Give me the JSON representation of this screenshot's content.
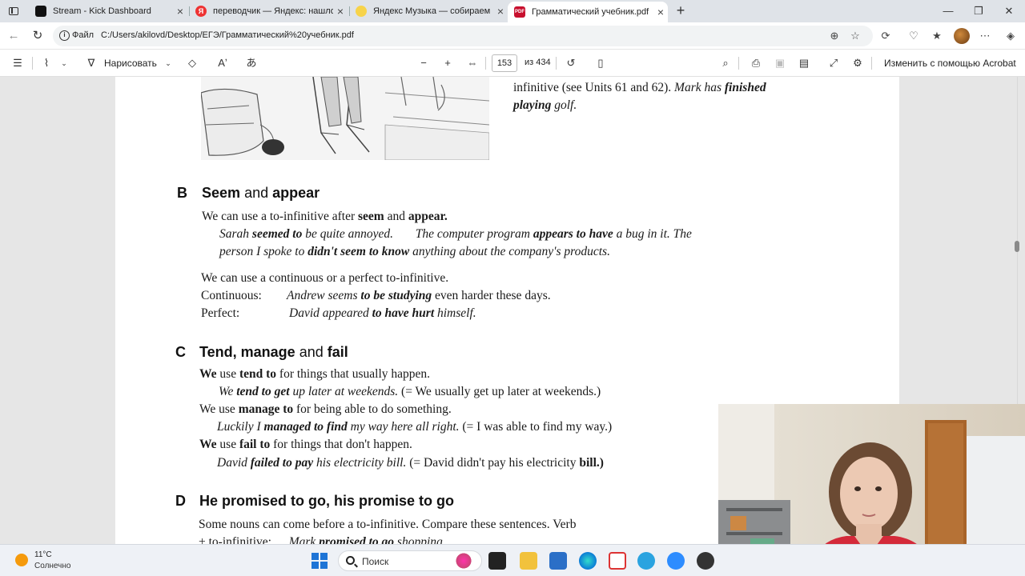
{
  "browser": {
    "tabs": [
      {
        "label": "Stream - Kick Dashboard",
        "favicon": "kick-icon",
        "active": false
      },
      {
        "label": "переводчик — Яндекс: нашлось",
        "favicon": "yandex-icon",
        "active": false
      },
      {
        "label": "Яндекс Музыка — собираем му",
        "favicon": "yandex-music-icon",
        "active": false
      },
      {
        "label": "Грамматический учебник.pdf",
        "favicon": "pdf-icon",
        "active": true
      }
    ],
    "address": {
      "scheme_label": "Файл",
      "url": "C:/Users/akilovd/Desktop/ЕГЭ/Грамматический%20учебник.pdf"
    }
  },
  "pdf_toolbar": {
    "draw_label": "Нарисовать",
    "page_current": "153",
    "page_total": "из 434",
    "edit_acrobat_label": "Изменить с помощью Acrobat"
  },
  "document": {
    "intro": {
      "line1_plain": "infinitive (see Units 61 and 62).",
      "line1_ex1": "Mark has",
      "line1_ex2": "finished",
      "line2_bold": "playing",
      "line2_rest": "golf."
    },
    "section_b": {
      "letter": "B",
      "title_1": "Seem",
      "title_2": "and",
      "title_3": "appear",
      "rule_1": "We can use a to-infinitive after",
      "rule_seem": "seem",
      "rule_and": "and",
      "rule_appear": "appear.",
      "ex1_a": "Sarah",
      "ex1_b": "seemed to",
      "ex1_c": "be quite annoyed.",
      "ex2_a": "The computer program",
      "ex2_b": "appears to have",
      "ex2_c": "a bug in it.",
      "ex2_d": "The",
      "ex3_a": "person I spoke to",
      "ex3_b": "didn't seem to know",
      "ex3_c": "anything about the company's products.",
      "rule_2": "We can use a continuous or a perfect to-infinitive.",
      "cont_label": "Continuous:",
      "cont_a": "Andrew seems",
      "cont_b": "to be studying",
      "cont_c": "even harder these days.",
      "perf_label": "Perfect:",
      "perf_a": "David appeared",
      "perf_b": "to have hurt",
      "perf_c": "himself."
    },
    "section_c": {
      "letter": "C",
      "title_1": "Tend, manage",
      "title_2": "and",
      "title_3": "fail",
      "r1_a": "We",
      "r1_b": "use",
      "r1_c": "tend to",
      "r1_d": "for things that usually happen.",
      "e1_a": "We",
      "e1_b": "tend to get",
      "e1_c": "up later at weekends.",
      "e1_d": "(= We usually get up later at weekends.)",
      "r2_a": "We use",
      "r2_b": "manage to",
      "r2_c": "for being able to do something.",
      "e2_a": "Luckily I",
      "e2_b": "managed to find",
      "e2_c": "my way here all right.",
      "e2_d": "(= I was able to find my way.)",
      "r3_a": "We",
      "r3_b": "use",
      "r3_c": "fail to",
      "r3_d": "for things that don't happen.",
      "e3_a": "David",
      "e3_b": "failed to pay",
      "e3_c": "his electricity bill.",
      "e3_d": "(= David didn't pay his electricity",
      "e3_e": "bill.)"
    },
    "section_d": {
      "letter": "D",
      "title": "He promised to go, his promise to go",
      "text": "Some nouns can come before a to-infinitive. Compare these sentences. Verb",
      "cut_a": "+ to-infinitive:",
      "cut_b": "Mark",
      "cut_c": "promised to go",
      "cut_d": "shopping."
    }
  },
  "taskbar": {
    "temp": "11°C",
    "weather": "Солнечно",
    "search_label": "Поиск"
  },
  "colors": {
    "tabstrip": "#dfe3e8",
    "page_bg": "#ffffff",
    "taskbar": "#eef1f6",
    "cam_shirt": "#d42a3a"
  }
}
